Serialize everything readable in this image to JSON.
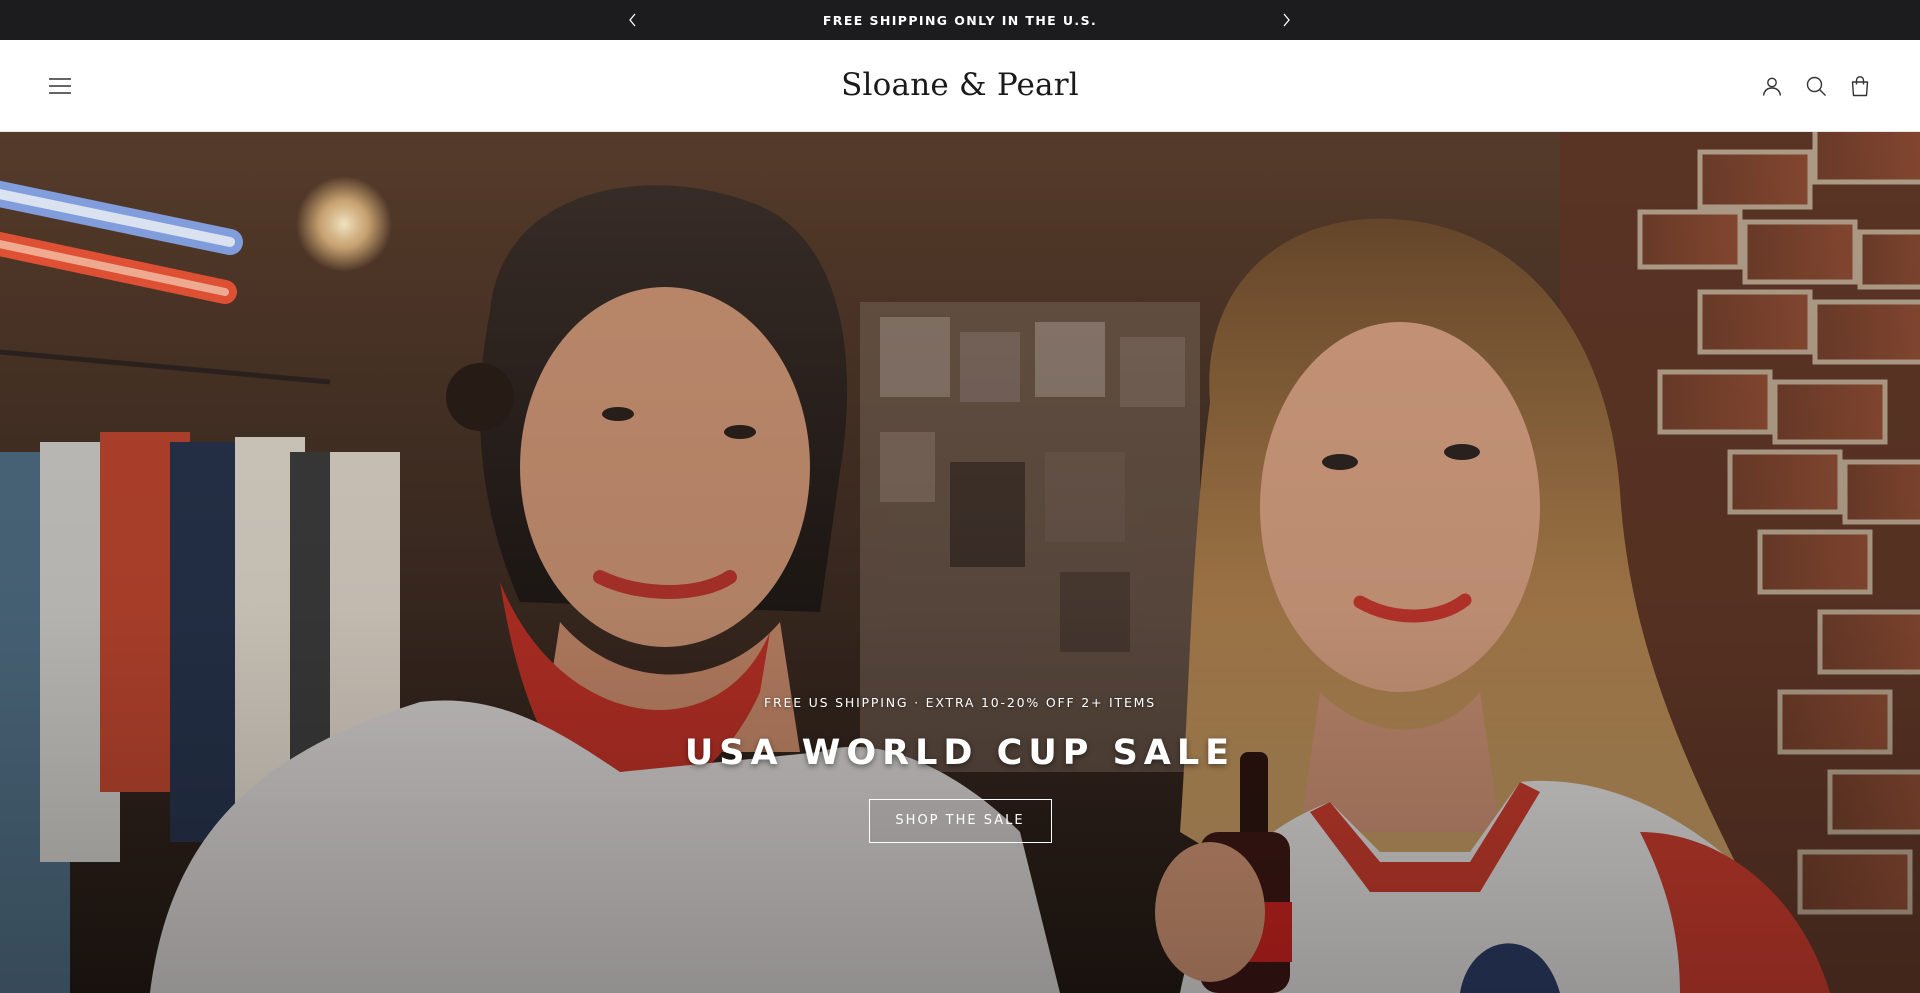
{
  "announcement": {
    "text": "FREE SHIPPING ONLY IN THE U.S.",
    "prev_icon": "chevron-left-icon",
    "next_icon": "chevron-right-icon"
  },
  "header": {
    "brand": "Sloane & Pearl",
    "menu_icon": "hamburger-menu-icon",
    "account_icon": "user-account-icon",
    "search_icon": "search-icon",
    "cart_icon": "shopping-bag-icon"
  },
  "hero": {
    "eyebrow": "FREE US SHIPPING · EXTRA 10-20% OFF 2+ ITEMS",
    "title": "USA WORLD CUP SALE",
    "cta_label": "SHOP THE SALE"
  },
  "colors": {
    "announcement_bg": "#1c1c1e",
    "header_bg": "#ffffff",
    "text_dark": "#1a1a1a",
    "hero_text": "#ffffff"
  }
}
